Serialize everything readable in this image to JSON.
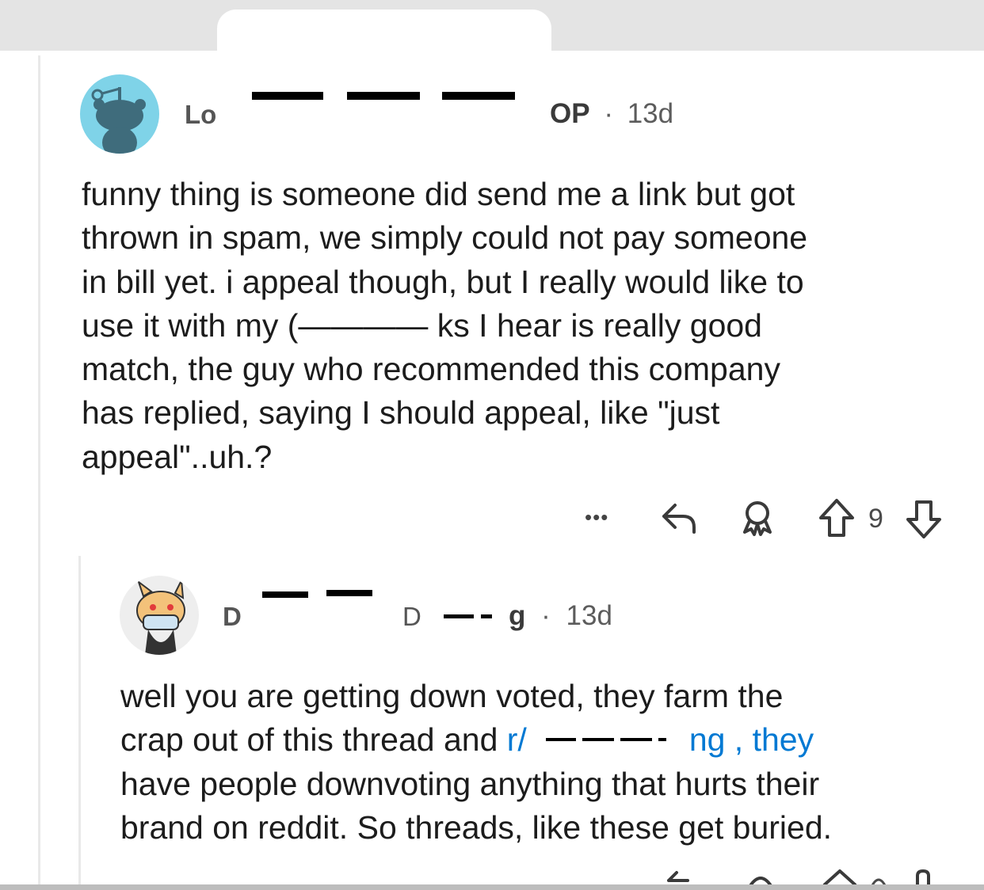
{
  "comment1": {
    "username_visible": "Lo",
    "op_label": "OP",
    "separator": "·",
    "age": "13d",
    "body_lines": [
      "funny thing is someone did send me a link but got",
      "thrown in spam, we simply could not pay someone",
      "in bill yet. i appeal though, but I really would like to",
      "use it with my (———— ks I hear is really good",
      "match, the guy who recommended this company",
      "has replied, saying I should appeal, like \"just",
      "appeal\"..uh.?"
    ],
    "actions": {
      "more_label": "•••",
      "vote_count": "9"
    }
  },
  "comment2": {
    "username_visible": "D",
    "flair_visible": "D",
    "username_tail": "g",
    "separator": "·",
    "age": "13d",
    "body_line1": "well you are getting down voted, they farm the",
    "body_line2_before": "crap out of this thread and ",
    "body_line2_link": "r/",
    "body_line2_after": "ng , they",
    "body_line3": "have people downvoting anything that hurts their",
    "body_line4": "brand on reddit. So threads, like these get buried."
  },
  "colors": {
    "link": "#0079d3",
    "avatar1_bg": "#7fd3e8",
    "text": "#1c1c1c",
    "meta": "#5c5c5c"
  },
  "icons": [
    "snoo-avatar",
    "doge-snoo-avatar",
    "more-icon",
    "reply-icon",
    "award-icon",
    "upvote-icon",
    "downvote-icon"
  ]
}
